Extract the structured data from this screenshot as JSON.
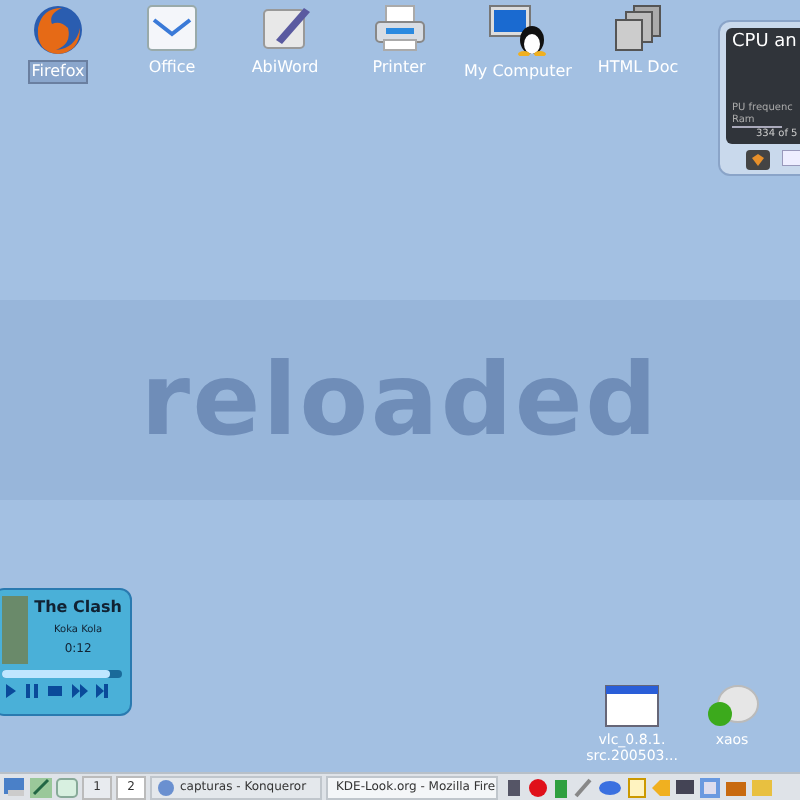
{
  "wallpaper": {
    "text": "reloaded"
  },
  "desktop_icons": [
    {
      "label": "Firefox",
      "kind": "firefox",
      "selected": true
    },
    {
      "label": "Office",
      "kind": "office",
      "selected": false
    },
    {
      "label": "AbiWord",
      "kind": "abiword",
      "selected": false
    },
    {
      "label": "Printer",
      "kind": "printer",
      "selected": false
    },
    {
      "label": "My Computer",
      "kind": "computer",
      "selected": false
    },
    {
      "label": "HTML Doc",
      "kind": "html",
      "selected": false
    }
  ],
  "cpu_widget": {
    "title": "CPU an",
    "line_1": "PU frequenc",
    "line_2": "Ram",
    "line_3": "334 of 5"
  },
  "player": {
    "artist": "The Clash",
    "title": "Koka Kola",
    "time": "0:12",
    "level": 0.9
  },
  "bottom_icons": [
    {
      "label": "vlc_0.8.1.\nsrc.200503...",
      "kind": "window"
    },
    {
      "label": "xaos",
      "kind": "xaos"
    }
  ],
  "taskbar": {
    "pager": [
      {
        "label": "1",
        "selected": false
      },
      {
        "label": "2",
        "selected": true
      }
    ],
    "tasks": [
      {
        "label": "capturas - Konqueror",
        "kind": "konqueror",
        "selected": false
      },
      {
        "label": "KDE-Look.org - Mozilla Fire",
        "kind": "firefox",
        "selected": true
      }
    ]
  }
}
